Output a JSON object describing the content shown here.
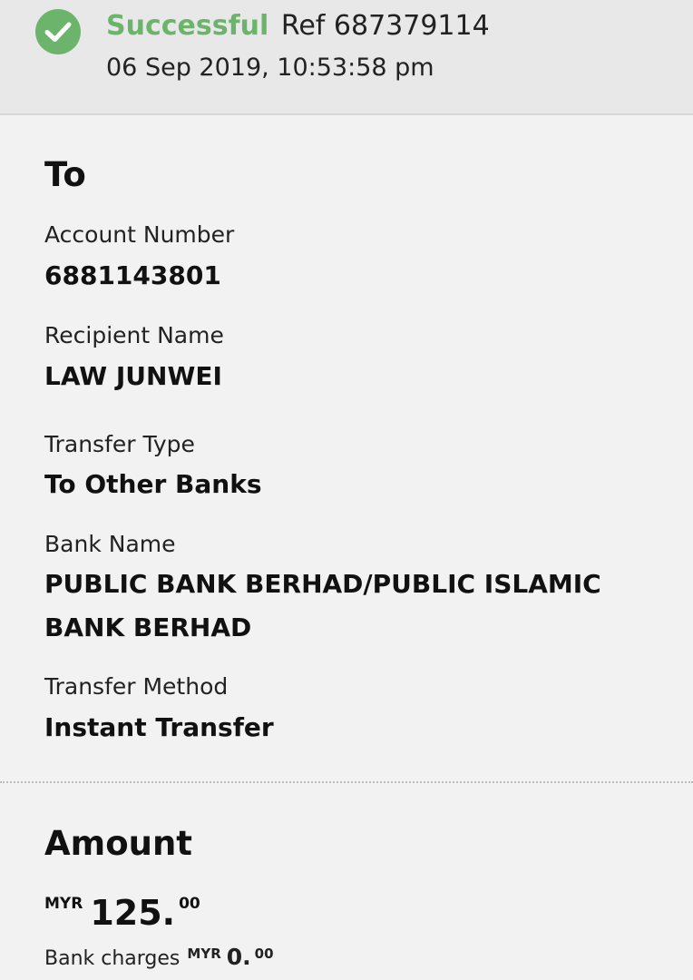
{
  "status": {
    "state": "Successful",
    "ref_text": "Ref 687379114",
    "datetime": "06 Sep 2019, 10:53:58 pm",
    "success_color": "#6cb46c",
    "icon": "check-circle-icon"
  },
  "to_section": {
    "title": "To",
    "fields": [
      {
        "label": "Account Number",
        "value": "6881143801"
      },
      {
        "label": "Recipient Name",
        "value": "LAW JUNWEI"
      },
      {
        "label": "Transfer Type",
        "value": "To Other Banks"
      },
      {
        "label": "Bank Name",
        "value": "PUBLIC BANK BERHAD/PUBLIC ISLAMIC BANK BERHAD"
      },
      {
        "label": "Transfer Method",
        "value": "Instant Transfer"
      }
    ]
  },
  "amount_section": {
    "title": "Amount",
    "currency": "MYR",
    "amount_int": "125.",
    "amount_dec": "00",
    "charges_label": "Bank charges",
    "charges_currency": "MYR",
    "charges_int": "0.",
    "charges_dec": "00"
  }
}
